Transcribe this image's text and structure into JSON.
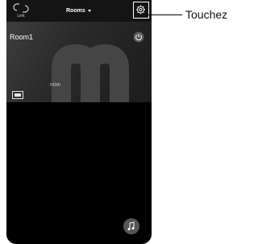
{
  "header": {
    "link_label": "Link",
    "rooms_title": "Rooms",
    "link_icon": "link-icon",
    "settings_icon": "gear-icon"
  },
  "room": {
    "name": "Room1",
    "power_icon": "power-icon",
    "source_icon": "hdmi-icon",
    "source_label": "HDMI",
    "watermark_letter": "m"
  },
  "fab": {
    "icon": "music-note-icon"
  },
  "callout": {
    "text": "Touchez"
  },
  "colors": {
    "highlight": "#ffffff",
    "background": "#000000",
    "card": "#2e2e2e"
  }
}
